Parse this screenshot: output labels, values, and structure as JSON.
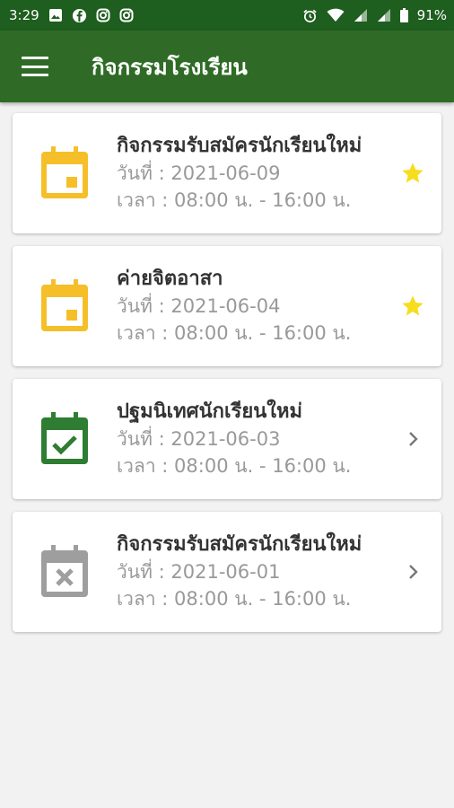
{
  "status_bar": {
    "time": "3:29",
    "battery": "91%"
  },
  "app_bar": {
    "title": "กิจกรรมโรงเรียน"
  },
  "colors": {
    "primary": "#2f6b27",
    "upcoming": "#f5bf2a",
    "done": "#2e7d32",
    "cancelled": "#9e9e9e",
    "star": "#f7dd1e"
  },
  "events": [
    {
      "title": "กิจกรรมรับสมัครนักเรียนใหม่",
      "date": "วันที่ : 2021-06-09",
      "time": "เวลา : 08:00 น. - 16:00 น.",
      "status": "upcoming",
      "icon": "calendar-icon",
      "action": "star-icon"
    },
    {
      "title": "ค่ายจิตอาสา",
      "date": "วันที่ : 2021-06-04",
      "time": "เวลา : 08:00 น. - 16:00 น.",
      "status": "upcoming",
      "icon": "calendar-icon",
      "action": "star-icon"
    },
    {
      "title": "ปฐมนิเทศนักเรียนใหม่",
      "date": "วันที่ : 2021-06-03",
      "time": "เวลา : 08:00 น. - 16:00 น.",
      "status": "done",
      "icon": "calendar-check-icon",
      "action": "chevron-right-icon"
    },
    {
      "title": "กิจกรรมรับสมัครนักเรียนใหม่",
      "date": "วันที่ : 2021-06-01",
      "time": "เวลา : 08:00 น. - 16:00 น.",
      "status": "cancelled",
      "icon": "calendar-remove-icon",
      "action": "chevron-right-icon"
    }
  ]
}
